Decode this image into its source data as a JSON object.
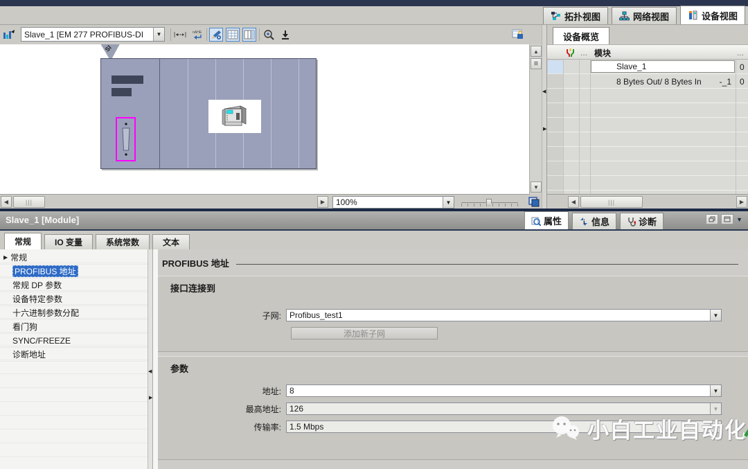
{
  "colors": {
    "selection_blue": "#2e6bc6",
    "highlight_magenta": "#ff00ff",
    "navy_divider": "#1c2a45",
    "toolbar_gray": "#cbcac5",
    "rack_fill": "#9aa0ba"
  },
  "view_tabs": {
    "topology": "拓扑视图",
    "network": "网络视图",
    "device": "设备视图"
  },
  "device_toolbar": {
    "device_selector_value": "Slave_1 [EM 277 PROFIBUS-DI"
  },
  "canvas": {
    "slot_flag": "Sl"
  },
  "device_statusbar": {
    "zoom_value": "100%"
  },
  "device_overview": {
    "tab_label": "设备概览",
    "header": {
      "module": "模块",
      "ellipsis_left": "...",
      "ellipsis_right": "..."
    },
    "rows": [
      {
        "module": "Slave_1",
        "suffix": "",
        "rack": "0"
      },
      {
        "module": "8 Bytes Out/ 8 Bytes In",
        "suffix": "-_1",
        "rack": "0"
      }
    ]
  },
  "inspector": {
    "title": "Slave_1 [Module]",
    "tabs": {
      "properties": "属性",
      "info": "信息",
      "diagnostics": "诊断"
    },
    "category_tabs": [
      "常规",
      "IO 变量",
      "系统常数",
      "文本"
    ],
    "nav": [
      "常规",
      "PROFIBUS 地址",
      "常规 DP 参数",
      "设备特定参数",
      "十六进制参数分配",
      "看门狗",
      "SYNC/FREEZE",
      "诊断地址"
    ],
    "content": {
      "heading": "PROFIBUS 地址",
      "interface_group": {
        "title": "接口连接到",
        "subnet_label": "子网:",
        "subnet_value": "Profibus_test1",
        "add_subnet_button": "添加新子网"
      },
      "params_group": {
        "title": "参数",
        "address_label": "地址:",
        "address_value": "8",
        "highest_address_label": "最高地址:",
        "highest_address_value": "126",
        "baud_label": "传输率:",
        "baud_value": "1.5 Mbps"
      }
    }
  },
  "watermark": {
    "text": "小白工业自动化"
  }
}
